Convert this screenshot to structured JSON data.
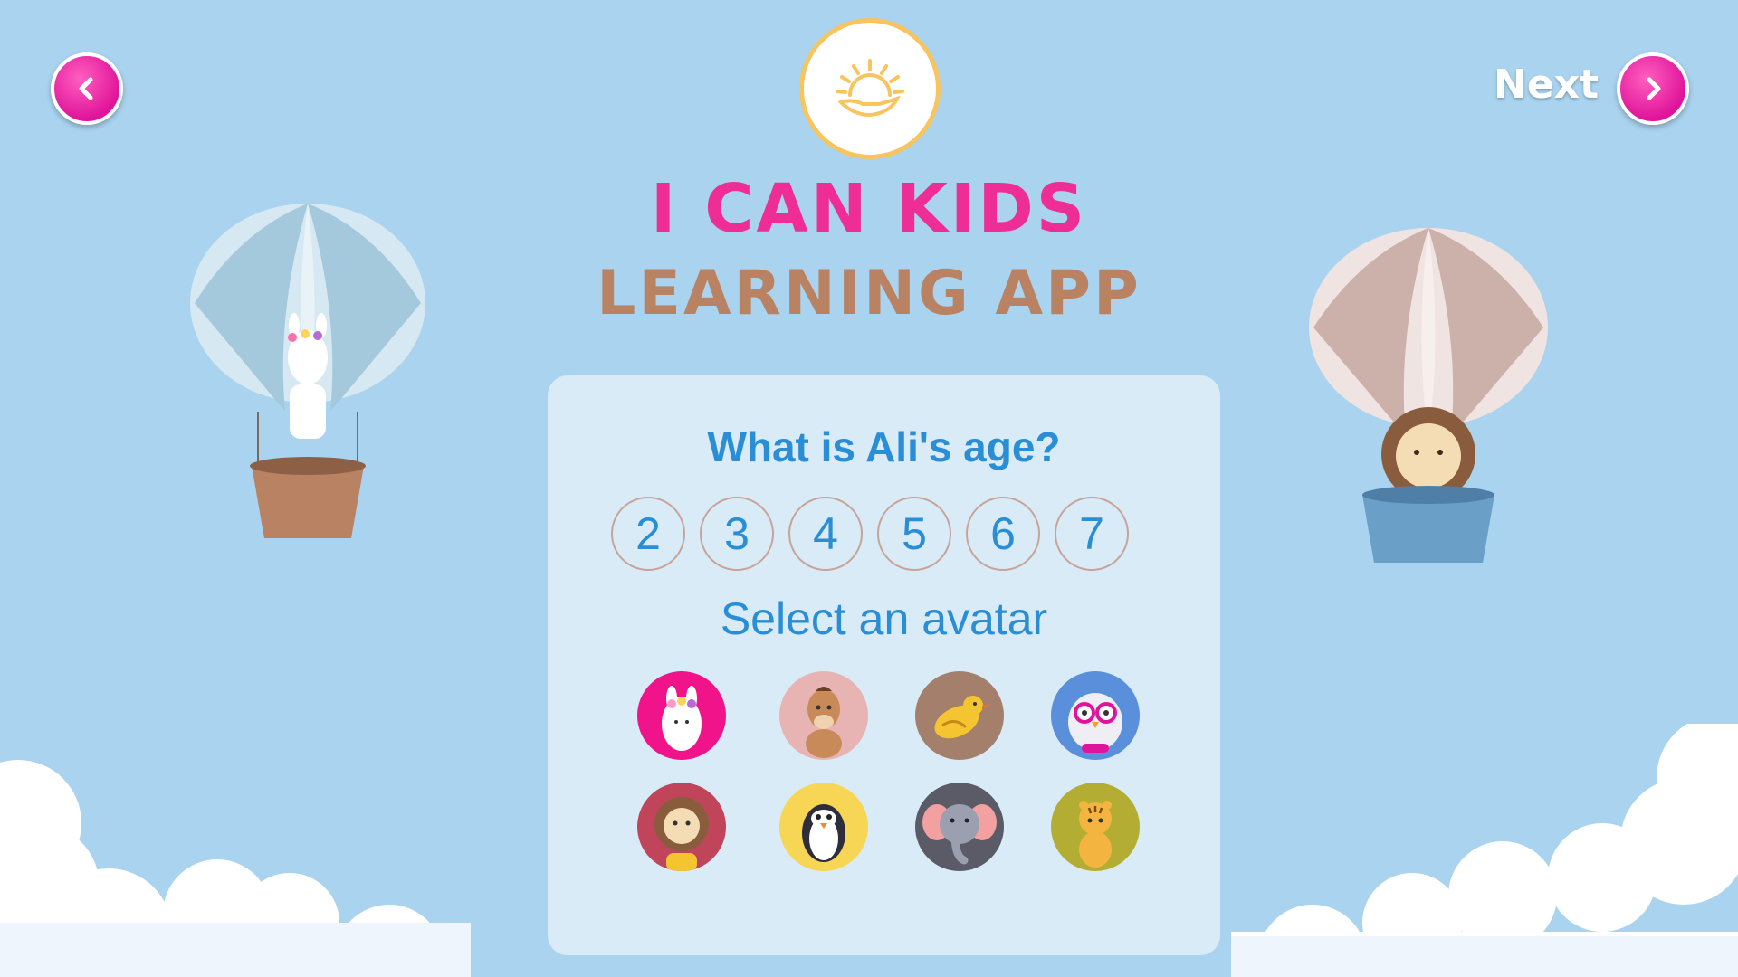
{
  "nav": {
    "back_icon": "chevron-left-icon",
    "next_label": "Next",
    "next_icon": "chevron-right-icon"
  },
  "logo": {
    "icon": "sun-hand-icon",
    "color": "#f7c45d"
  },
  "title": {
    "line1": "I CAN KIDS",
    "line2": "LEARNING APP",
    "line1_color": "#ee2e96",
    "line2_color": "#b98263"
  },
  "form": {
    "question": "What is Ali's age?",
    "ages": [
      "2",
      "3",
      "4",
      "5",
      "6",
      "7"
    ],
    "avatar_prompt": "Select an avatar",
    "avatars": [
      {
        "name": "llama",
        "bg": "#f0138a"
      },
      {
        "name": "horse",
        "bg": "#e8b4b3"
      },
      {
        "name": "bird",
        "bg": "#a4806c"
      },
      {
        "name": "owl",
        "bg": "#5a8fdb"
      },
      {
        "name": "lion",
        "bg": "#c0455a"
      },
      {
        "name": "penguin",
        "bg": "#f7d555"
      },
      {
        "name": "elephant",
        "bg": "#5a5b67"
      },
      {
        "name": "tiger",
        "bg": "#b3ad33"
      }
    ]
  },
  "colors": {
    "background": "#a9d3ee",
    "panel": "#d9ebf7",
    "accent": "#2a8ed6",
    "button": "#e0149a"
  }
}
